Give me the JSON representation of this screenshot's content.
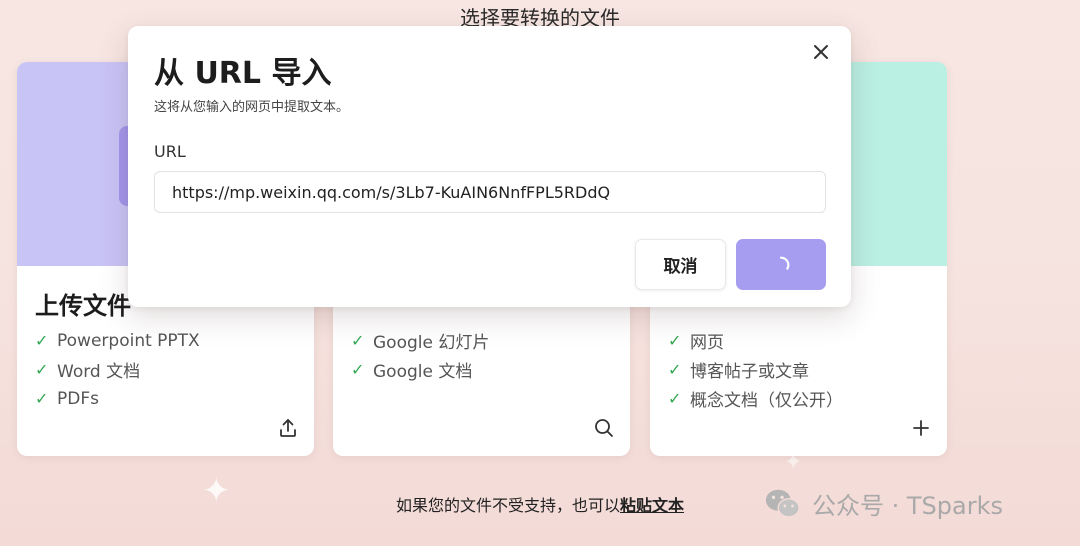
{
  "page": {
    "heading": "选择要转换的文件",
    "footer_text": "如果您的文件不受支持，也可以",
    "footer_link": "粘贴文本"
  },
  "cards": [
    {
      "title": "上传文件",
      "top_color": "#c9c4f6",
      "features": [
        "Powerpoint PPTX",
        "Word 文档",
        "PDFs"
      ],
      "action_icon": "upload-icon"
    },
    {
      "title": "",
      "top_color": "#f6dede",
      "features": [
        "Google 幻灯片",
        "Google 文档"
      ],
      "action_icon": "search-icon"
    },
    {
      "title": "",
      "top_color": "#b9f0e3",
      "features": [
        "网页",
        "博客帖子或文章",
        "概念文档（仅公开）"
      ],
      "action_icon": "plus-icon"
    }
  ],
  "dialog": {
    "title": "从 URL 导入",
    "subtitle": "这将从您输入的网页中提取文本。",
    "field_label": "URL",
    "url_value": "https://mp.weixin.qq.com/s/3Lb7-KuAIN6NnfFPL5RDdQ",
    "cancel_label": "取消",
    "submit_state": "loading",
    "submit_icon": "spinner-icon",
    "close_icon": "close-icon",
    "accent_color": "#a69cf0"
  },
  "watermark": {
    "text": "公众号 · TSparks",
    "icon": "wechat-icon"
  }
}
